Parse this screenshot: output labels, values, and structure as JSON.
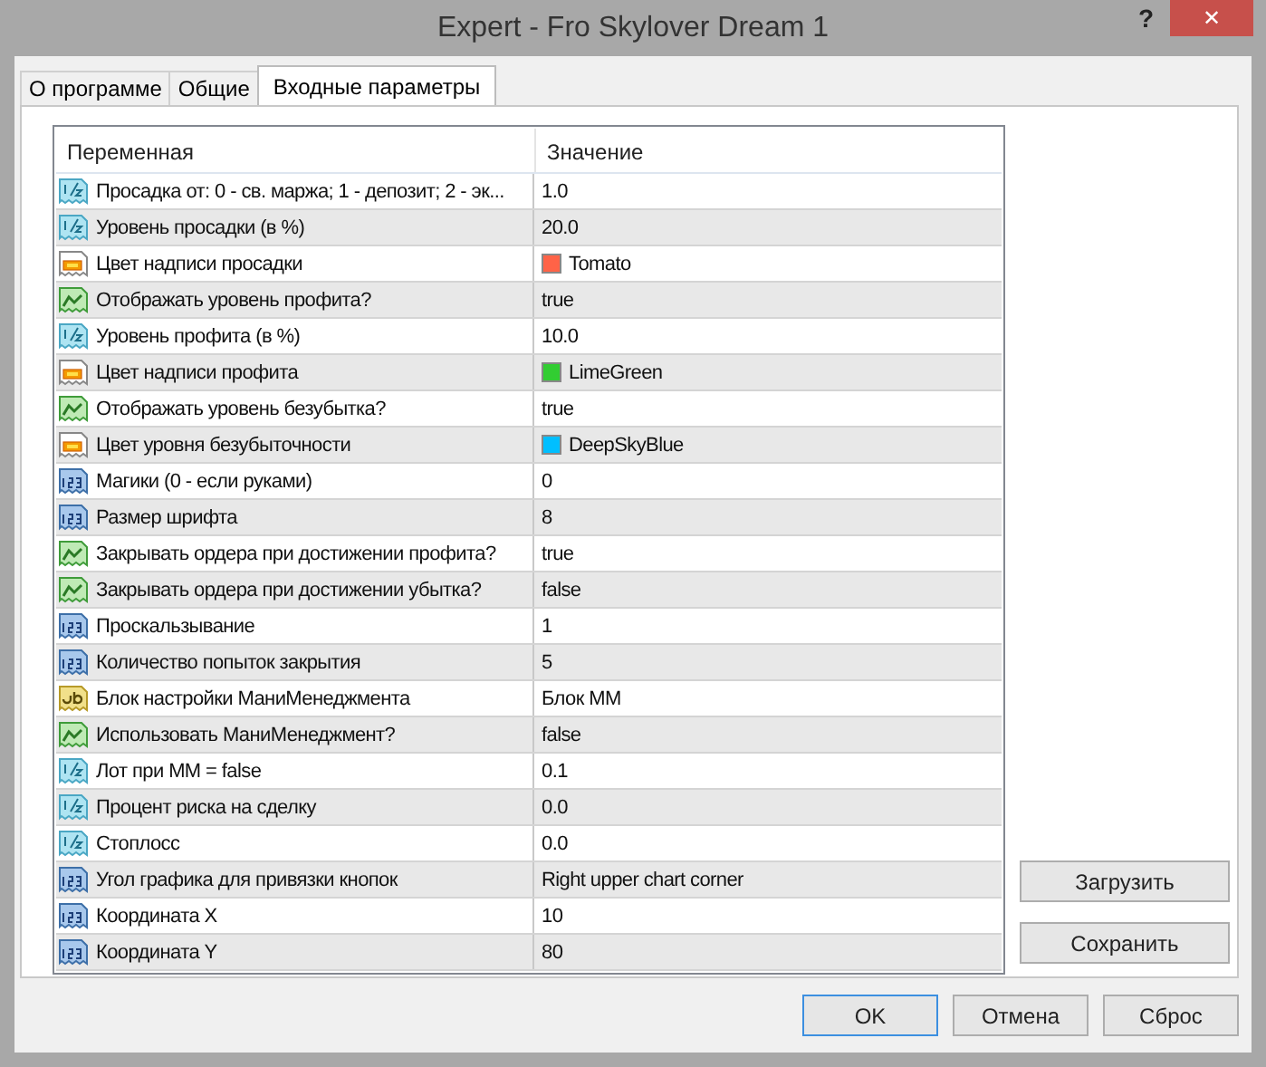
{
  "window": {
    "title": "Expert - Fro Skylover Dream 1",
    "help": "?",
    "close": "✕"
  },
  "tabs": [
    {
      "label": "О программе",
      "selected": false
    },
    {
      "label": "Общие",
      "selected": false
    },
    {
      "label": "Входные параметры",
      "selected": true
    }
  ],
  "table": {
    "columns": [
      "Переменная",
      "Значение"
    ],
    "rows": [
      {
        "kind": "double",
        "name": "Просадка от: 0 - св. маржа; 1 - депозит; 2 - эк...",
        "value": "1.0"
      },
      {
        "kind": "double",
        "name": "Уровень просадки (в %)",
        "value": "20.0"
      },
      {
        "kind": "color",
        "name": "Цвет надписи просадки",
        "value": "Tomato",
        "color": "#ff6347"
      },
      {
        "kind": "bool",
        "name": "Отображать уровень профита?",
        "value": "true"
      },
      {
        "kind": "double",
        "name": "Уровень профита (в %)",
        "value": "10.0"
      },
      {
        "kind": "color",
        "name": "Цвет надписи профита",
        "value": "LimeGreen",
        "color": "#32cd32"
      },
      {
        "kind": "bool",
        "name": "Отображать уровень безубытка?",
        "value": "true"
      },
      {
        "kind": "color",
        "name": "Цвет уровня безубыточности",
        "value": "DeepSkyBlue",
        "color": "#00bfff"
      },
      {
        "kind": "int",
        "name": "Магики (0 - если руками)",
        "value": "0"
      },
      {
        "kind": "int",
        "name": "Размер шрифта",
        "value": "8"
      },
      {
        "kind": "bool",
        "name": "Закрывать ордера при достижении профита?",
        "value": "true"
      },
      {
        "kind": "bool",
        "name": "Закрывать ордера при достижении убытка?",
        "value": "false"
      },
      {
        "kind": "int",
        "name": "Проскальзывание",
        "value": "1"
      },
      {
        "kind": "int",
        "name": "Количество попыток закрытия",
        "value": "5"
      },
      {
        "kind": "string",
        "name": "Блок настройки МаниМенеджмента",
        "value": "Блок ММ"
      },
      {
        "kind": "bool",
        "name": "Использовать МаниМенеджмент?",
        "value": "false"
      },
      {
        "kind": "double",
        "name": "Лот при ММ = false",
        "value": "0.1"
      },
      {
        "kind": "double",
        "name": "Процент риска на сделку",
        "value": "0.0"
      },
      {
        "kind": "double",
        "name": "Стоплосс",
        "value": "0.0"
      },
      {
        "kind": "int",
        "name": "Угол графика для привязки кнопок",
        "value": "Right upper chart corner"
      },
      {
        "kind": "int",
        "name": "Координата X",
        "value": "10"
      },
      {
        "kind": "int",
        "name": "Координата Y",
        "value": "80"
      }
    ]
  },
  "side_buttons": [
    "Загрузить",
    "Сохранить"
  ],
  "buttons": [
    {
      "label": "OK",
      "default": true
    },
    {
      "label": "Отмена",
      "default": false
    },
    {
      "label": "Сброс",
      "default": false
    }
  ]
}
